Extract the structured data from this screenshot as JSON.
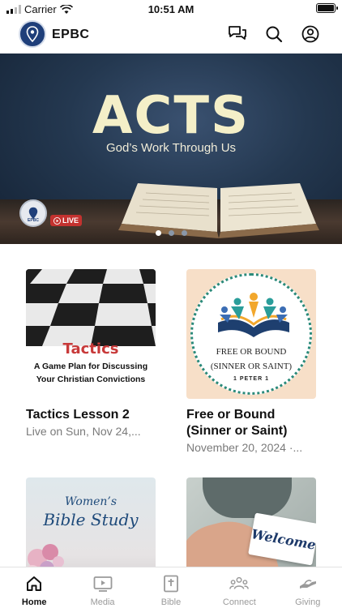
{
  "status_bar": {
    "carrier": "Carrier",
    "time": "10:51 AM"
  },
  "header": {
    "app_name": "EPBC",
    "icons": [
      "chat-icon",
      "search-icon",
      "profile-icon"
    ]
  },
  "banner": {
    "title": "ACTS",
    "subtitle": "God’s Work Through Us",
    "logo_text": "EPBC",
    "live_label": "LIVE",
    "pages": 3,
    "active_page": 1
  },
  "cards": [
    {
      "title": "Tactics Lesson 2",
      "subtitle": "Live on Sun, Nov 24,...",
      "image": {
        "word": "Tactics",
        "line1": "A Game Plan for Discussing",
        "line2": "Your Christian Convictions"
      }
    },
    {
      "title": "Free or Bound (Sinner or Saint)",
      "subtitle": "November 20, 2024 ·...",
      "image": {
        "line1": "FREE OR BOUND",
        "line2": "(SINNER OR SAINT)",
        "line3": "1 PETER 1"
      }
    },
    {
      "title": "",
      "subtitle": "",
      "image": {
        "line1": "Women’s",
        "line2": "Bible Study"
      }
    },
    {
      "title": "",
      "subtitle": "",
      "image": {
        "word": "Welcome"
      }
    }
  ],
  "tabs": [
    {
      "label": "Home",
      "icon": "home-icon",
      "active": true
    },
    {
      "label": "Media",
      "icon": "media-icon",
      "active": false
    },
    {
      "label": "Bible",
      "icon": "bible-icon",
      "active": false
    },
    {
      "label": "Connect",
      "icon": "connect-icon",
      "active": false
    },
    {
      "label": "Giving",
      "icon": "giving-icon",
      "active": false
    }
  ],
  "colors": {
    "brand": "#1f3f7a",
    "live": "#c3322f",
    "tactics_red": "#c83a3a"
  }
}
